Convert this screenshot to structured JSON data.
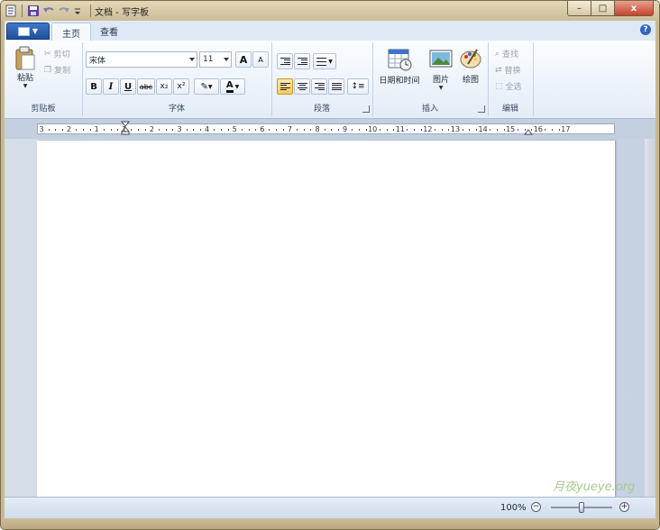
{
  "window": {
    "title": "文档 - 写字板",
    "controls": {
      "minimize": "–",
      "maximize": "□",
      "close": "x"
    }
  },
  "tabs": [
    {
      "label": "主页",
      "active": true
    },
    {
      "label": "查看",
      "active": false
    }
  ],
  "help_glyph": "?",
  "ribbon": {
    "clipboard": {
      "label": "剪贴板",
      "paste": "粘贴",
      "cut": "剪切",
      "copy": "复制"
    },
    "font": {
      "label": "字体",
      "family": "宋体",
      "size": "11",
      "grow": "A",
      "shrink": "A",
      "bold": "B",
      "italic": "I",
      "underline": "U",
      "strikethrough": "abc",
      "subscript": "x₂",
      "superscript": "x²",
      "color_letter": "A"
    },
    "paragraph": {
      "label": "段落",
      "selected_alignment": "left"
    },
    "insert": {
      "label": "插入",
      "datetime": "日期和时间",
      "picture": "图片",
      "paint": "绘图"
    },
    "editing": {
      "label": "编辑",
      "find": "查找",
      "replace": "替换",
      "select_all": "全选"
    }
  },
  "ruler": {
    "numbers": [
      "3",
      "2",
      "1",
      "1",
      "2",
      "3",
      "4",
      "5",
      "6",
      "7",
      "8",
      "9",
      "10",
      "11",
      "12",
      "13",
      "14",
      "15",
      "16",
      "17"
    ]
  },
  "status": {
    "zoom": "100%",
    "zoom_level": 1.0,
    "zoom_out": "−",
    "zoom_in": "+"
  },
  "watermark": "月夜yueye.org",
  "colors": {
    "accent": "#2f66c3",
    "selected": "#f7c95c",
    "frame": "#c8b893"
  }
}
